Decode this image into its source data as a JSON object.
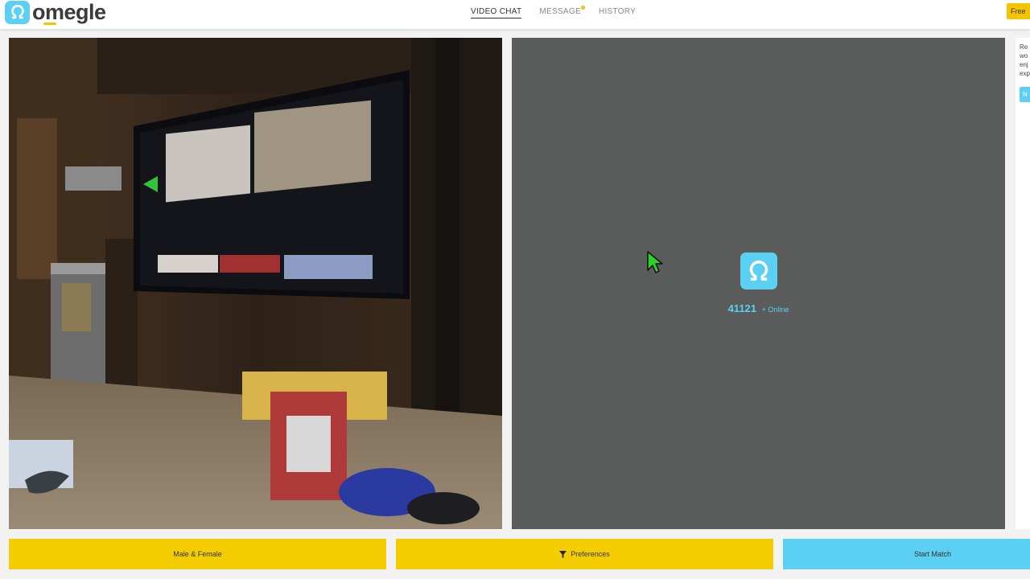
{
  "brand": {
    "name": "omegle",
    "icon": "omega-icon",
    "accent": "#5bd0f2",
    "yellow": "#f4cd00"
  },
  "nav": {
    "items": [
      {
        "label": "VIDEO CHAT",
        "active": true
      },
      {
        "label": "MESSAGE",
        "active": false,
        "badge_dot": true
      },
      {
        "label": "HISTORY",
        "active": false
      }
    ]
  },
  "header_right": {
    "free_label": "Free"
  },
  "side_promo": {
    "text_lines": [
      "Re",
      "wo",
      "enj",
      "exp"
    ],
    "button_label": "N"
  },
  "stranger_panel": {
    "online_count": "41121",
    "online_suffix": "+ Online"
  },
  "bottom_bar": {
    "gender_label": "Male & Female",
    "preferences_label": "Preferences",
    "start_label": "Start Match"
  }
}
